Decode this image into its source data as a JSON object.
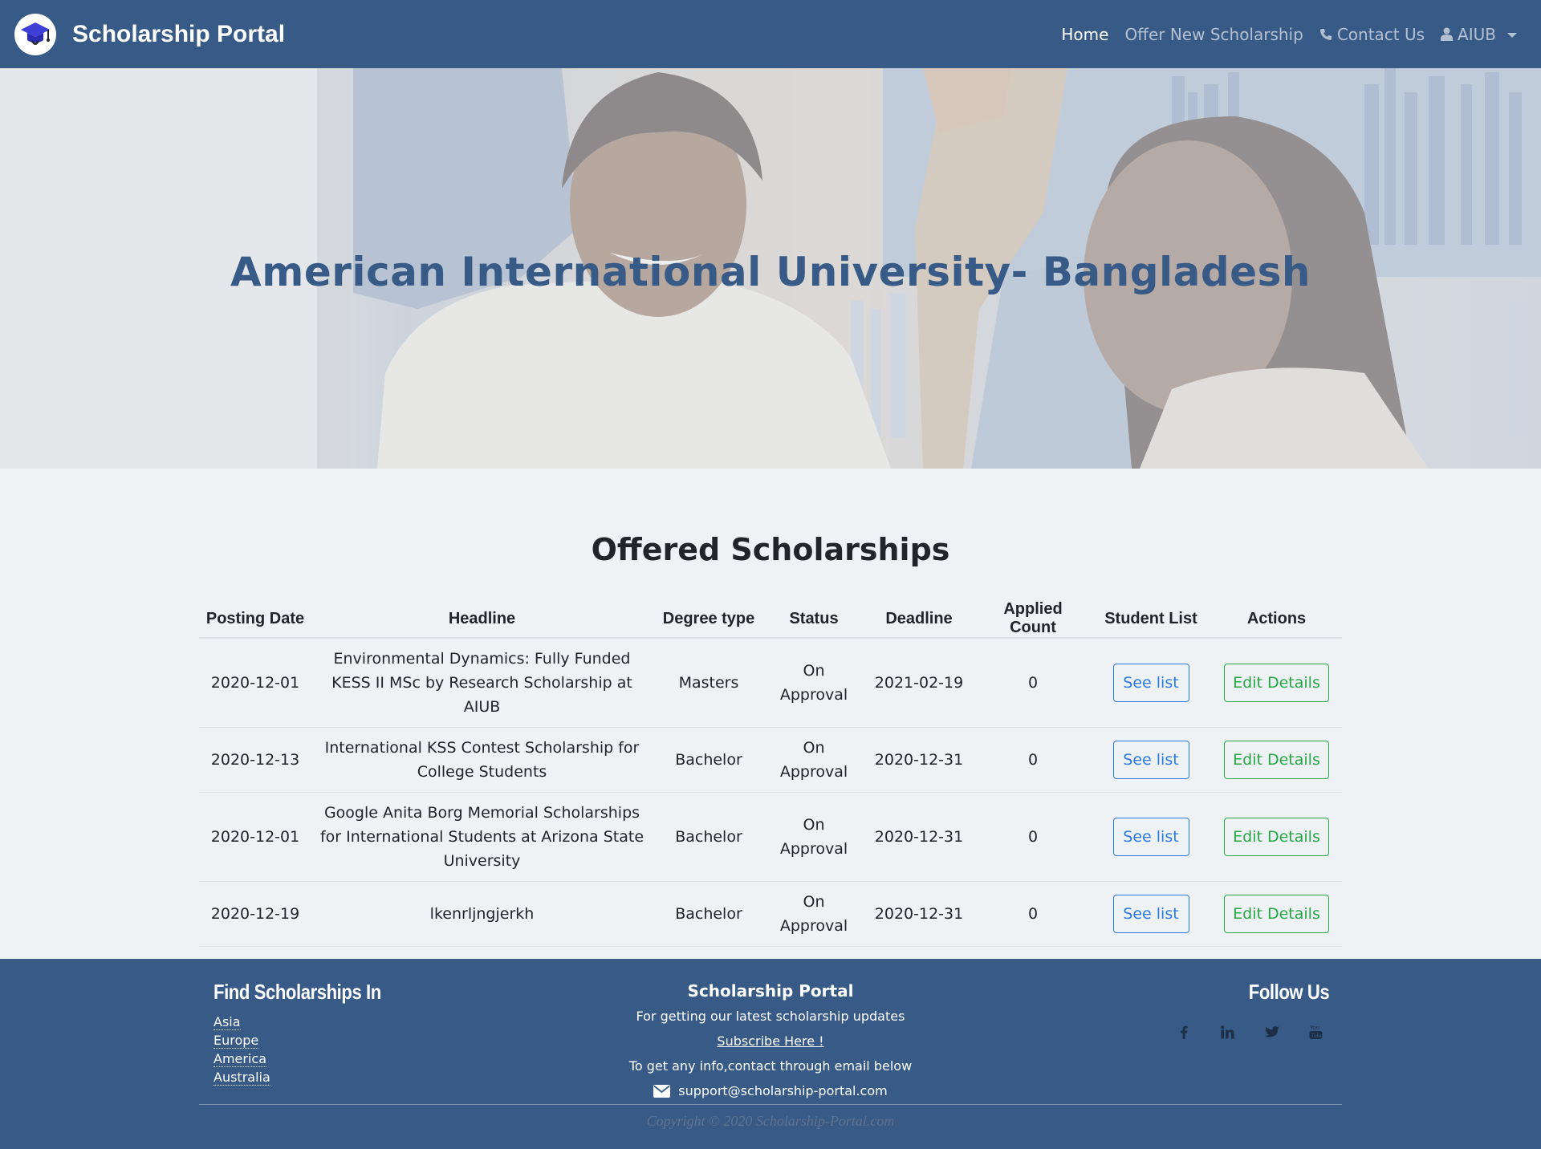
{
  "colors": {
    "primary": "#375a86",
    "page_bg": "#eef2f5",
    "see_list": "#2a7ae2",
    "edit_details": "#28a745"
  },
  "navbar": {
    "brand_icon": "graduation-cap-icon",
    "brand_title": "Scholarship Portal",
    "links": {
      "home": "Home",
      "offer_new": "Offer New Scholarship",
      "contact": "Contact Us",
      "user": "AIUB"
    }
  },
  "hero": {
    "title": "American International University- Bangladesh"
  },
  "section": {
    "title": "Offered Scholarships"
  },
  "table": {
    "headers": [
      "Posting Date",
      "Headline",
      "Degree type",
      "Status",
      "Deadline",
      "Applied Count",
      "Student List",
      "Actions"
    ],
    "see_list_label": "See list",
    "edit_label": "Edit Details",
    "rows": [
      {
        "posting_date": "2020-12-01",
        "headline": "Environmental Dynamics: Fully Funded KESS II MSc by Research Scholarship at AIUB",
        "degree": "Masters",
        "status": "On Approval",
        "deadline": "2021-02-19",
        "applied": "0"
      },
      {
        "posting_date": "2020-12-13",
        "headline": "International KSS Contest Scholarship for College Students",
        "degree": "Bachelor",
        "status": "On Approval",
        "deadline": "2020-12-31",
        "applied": "0"
      },
      {
        "posting_date": "2020-12-01",
        "headline": "Google Anita Borg Memorial Scholarships for International Students at Arizona State University",
        "degree": "Bachelor",
        "status": "On Approval",
        "deadline": "2020-12-31",
        "applied": "0"
      },
      {
        "posting_date": "2020-12-19",
        "headline": "lkenrljngjerkh",
        "degree": "Bachelor",
        "status": "On Approval",
        "deadline": "2020-12-31",
        "applied": "0"
      }
    ]
  },
  "footer": {
    "find_heading": "Find Scholarships In",
    "regions": [
      "Asia",
      "Europe",
      "America",
      "Australia"
    ],
    "site_name": "Scholarship Portal",
    "updates_text": "For getting our latest scholarship updates",
    "subscribe_label": "Subscribe Here !",
    "contact_text": "To get any info,contact through email below",
    "email": "support@scholarship-portal.com",
    "follow_heading": "Follow Us",
    "social_icons": [
      "facebook-icon",
      "linkedin-icon",
      "twitter-icon",
      "youtube-icon"
    ],
    "copyright": "Copyright © 2020 Scholarship-Portal.com"
  }
}
